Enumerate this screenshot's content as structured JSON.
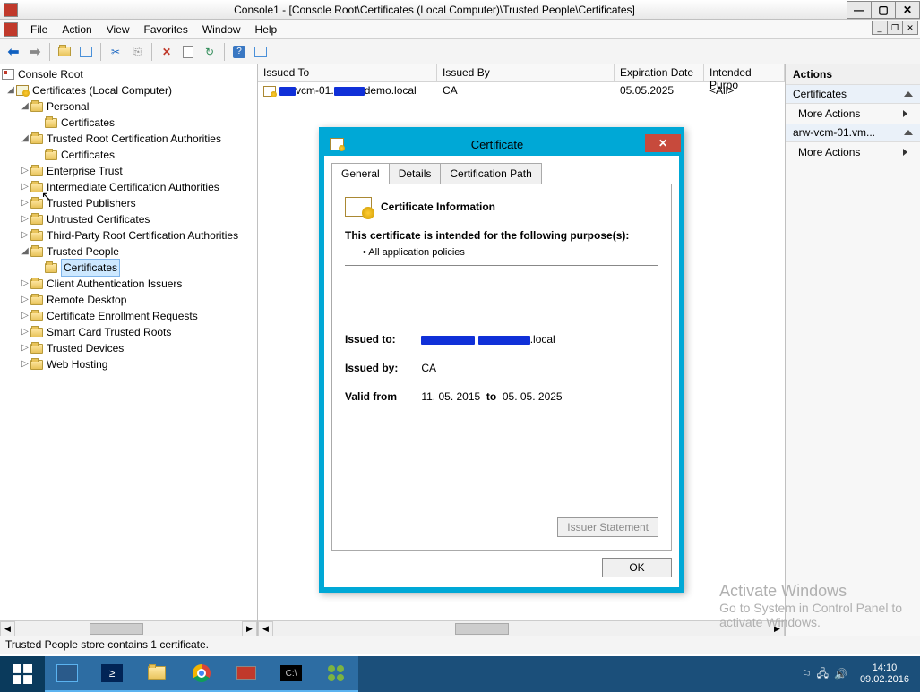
{
  "window": {
    "title": "Console1 - [Console Root\\Certificates (Local Computer)\\Trusted People\\Certificates]"
  },
  "menu": {
    "file": "File",
    "action": "Action",
    "view": "View",
    "favorites": "Favorites",
    "window": "Window",
    "help": "Help"
  },
  "tree": {
    "root": "Console Root",
    "certs_local": "Certificates (Local Computer)",
    "personal": "Personal",
    "personal_certs": "Certificates",
    "trca": "Trusted Root Certification Authorities",
    "trca_certs": "Certificates",
    "ent_trust": "Enterprise Trust",
    "ica": "Intermediate Certification Authorities",
    "tpub": "Trusted Publishers",
    "untrusted": "Untrusted Certificates",
    "tp_root": "Third-Party Root Certification Authorities",
    "trusted_people": "Trusted People",
    "trusted_people_certs": "Certificates",
    "cai": "Client Authentication Issuers",
    "rdp": "Remote Desktop",
    "cer": "Certificate Enrollment Requests",
    "sctr": "Smart Card Trusted Roots",
    "td": "Trusted Devices",
    "wh": "Web Hosting"
  },
  "list": {
    "cols": {
      "issued_to": "Issued To",
      "issued_by": "Issued By",
      "exp": "Expiration Date",
      "intended": "Intended Purpo"
    },
    "row": {
      "name_mid": "vcm-01.",
      "name_suffix": "demo.local",
      "issued_by": "CA",
      "exp": "05.05.2025",
      "intended": "<All>"
    }
  },
  "actions": {
    "header": "Actions",
    "certs": "Certificates",
    "more": "More Actions",
    "item": "arw-vcm-01.vm..."
  },
  "dialog": {
    "title": "Certificate",
    "tabs": {
      "general": "General",
      "details": "Details",
      "certpath": "Certification Path"
    },
    "info_title": "Certificate Information",
    "purpose_line": "This certificate is intended for the following purpose(s):",
    "purpose_item": "• All application policies",
    "issued_to_label": "Issued to:",
    "issued_to_suffix": ".local",
    "issued_by_label": "Issued by:",
    "issued_by_val": "CA",
    "valid_label": "Valid from",
    "valid_from": "11. 05. 2015",
    "valid_to_word": "to",
    "valid_to": "05. 05. 2025",
    "issuer_stmt": "Issuer Statement",
    "ok": "OK"
  },
  "status": "Trusted People store contains 1 certificate.",
  "watermark": {
    "l1": "Activate Windows",
    "l2": "Go to System in Control Panel to",
    "l3": "activate Windows."
  },
  "tray": {
    "time": "14:10",
    "date": "09.02.2016"
  }
}
